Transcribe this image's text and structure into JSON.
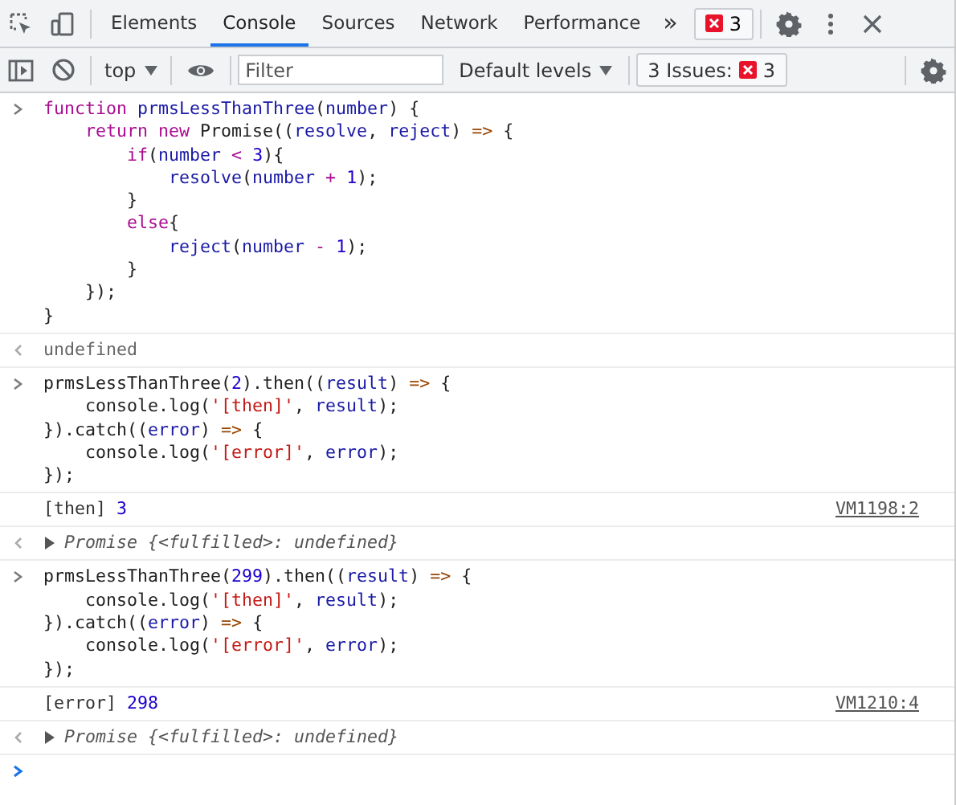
{
  "tabs": [
    {
      "label": "Elements",
      "selected": false
    },
    {
      "label": "Console",
      "selected": true
    },
    {
      "label": "Sources",
      "selected": false
    },
    {
      "label": "Network",
      "selected": false
    },
    {
      "label": "Performance",
      "selected": false
    }
  ],
  "more_tabs": "»",
  "error_count": "3",
  "console_toolbar": {
    "context": "top",
    "filter": {
      "placeholder": "Filter"
    },
    "levels": "Default levels",
    "issues": {
      "label": "3 Issues:",
      "count": "3"
    }
  },
  "entries": [
    {
      "kind": "input",
      "lines": [
        [
          {
            "t": "function",
            "kind": "keyword"
          },
          {
            "t": " prmsLessThanThree",
            "kind": "variable"
          },
          {
            "t": "("
          },
          {
            "t": "number",
            "kind": "variable"
          },
          {
            "t": ") {"
          }
        ],
        [
          {
            "t": "    return",
            "kind": "keyword"
          },
          {
            "t": " new",
            "kind": "keyword"
          },
          {
            "t": " Promise(("
          },
          {
            "t": "resolve",
            "kind": "variable"
          },
          {
            "t": ", "
          },
          {
            "t": "reject",
            "kind": "variable"
          },
          {
            "t": ") "
          },
          {
            "t": "=>",
            "kind": "operator"
          },
          {
            "t": " {"
          }
        ],
        [
          {
            "t": "        if",
            "kind": "keyword"
          },
          {
            "t": "("
          },
          {
            "t": "number",
            "kind": "variable"
          },
          {
            "t": " <",
            "kind": "keyword"
          },
          {
            "t": " 3",
            "kind": "number"
          },
          {
            "t": "){"
          }
        ],
        [
          {
            "t": "            resolve",
            "kind": "variable"
          },
          {
            "t": "("
          },
          {
            "t": "number",
            "kind": "variable"
          },
          {
            "t": " +",
            "kind": "keyword"
          },
          {
            "t": " 1",
            "kind": "number"
          },
          {
            "t": ");"
          }
        ],
        [
          {
            "t": "        }"
          }
        ],
        [
          {
            "t": "        else",
            "kind": "keyword"
          },
          {
            "t": "{"
          }
        ],
        [
          {
            "t": "            reject",
            "kind": "variable"
          },
          {
            "t": "("
          },
          {
            "t": "number",
            "kind": "variable"
          },
          {
            "t": " -",
            "kind": "keyword"
          },
          {
            "t": " 1",
            "kind": "number"
          },
          {
            "t": ");"
          }
        ],
        [
          {
            "t": "        }"
          }
        ],
        [
          {
            "t": "    });"
          }
        ],
        [
          {
            "t": "}"
          }
        ]
      ]
    },
    {
      "kind": "result",
      "text": "undefined"
    },
    {
      "kind": "input",
      "lines": [
        [
          {
            "t": "prmsLessThanThree("
          },
          {
            "t": "2",
            "kind": "number"
          },
          {
            "t": ").then(("
          },
          {
            "t": "result",
            "kind": "variable"
          },
          {
            "t": ") "
          },
          {
            "t": "=>",
            "kind": "operator"
          },
          {
            "t": " {"
          }
        ],
        [
          {
            "t": "    console.log("
          },
          {
            "t": "'[then]'",
            "kind": "string"
          },
          {
            "t": ", "
          },
          {
            "t": "result",
            "kind": "variable"
          },
          {
            "t": ");"
          }
        ],
        [
          {
            "t": "}).catch(("
          },
          {
            "t": "error",
            "kind": "variable"
          },
          {
            "t": ") "
          },
          {
            "t": "=>",
            "kind": "operator"
          },
          {
            "t": " {"
          }
        ],
        [
          {
            "t": "    console.log("
          },
          {
            "t": "'[error]'",
            "kind": "string"
          },
          {
            "t": ", "
          },
          {
            "t": "error",
            "kind": "variable"
          },
          {
            "t": ");"
          }
        ],
        [
          {
            "t": "});"
          }
        ]
      ]
    },
    {
      "kind": "log",
      "text": "[then]",
      "value": "3",
      "source": "VM1198:2"
    },
    {
      "kind": "promise",
      "text": "Promise {<fulfilled>: undefined}",
      "expanded": false
    },
    {
      "kind": "input",
      "lines": [
        [
          {
            "t": "prmsLessThanThree("
          },
          {
            "t": "299",
            "kind": "number"
          },
          {
            "t": ").then(("
          },
          {
            "t": "result",
            "kind": "variable"
          },
          {
            "t": ") "
          },
          {
            "t": "=>",
            "kind": "operator"
          },
          {
            "t": " {"
          }
        ],
        [
          {
            "t": "    console.log("
          },
          {
            "t": "'[then]'",
            "kind": "string"
          },
          {
            "t": ", "
          },
          {
            "t": "result",
            "kind": "variable"
          },
          {
            "t": ");"
          }
        ],
        [
          {
            "t": "}).catch(("
          },
          {
            "t": "error",
            "kind": "variable"
          },
          {
            "t": ") "
          },
          {
            "t": "=>",
            "kind": "operator"
          },
          {
            "t": " {"
          }
        ],
        [
          {
            "t": "    console.log("
          },
          {
            "t": "'[error]'",
            "kind": "string"
          },
          {
            "t": ", "
          },
          {
            "t": "error",
            "kind": "variable"
          },
          {
            "t": ");"
          }
        ],
        [
          {
            "t": "});"
          }
        ]
      ]
    },
    {
      "kind": "log",
      "text": "[error]",
      "value": "298",
      "source": "VM1210:4"
    },
    {
      "kind": "promise",
      "text": "Promise {<fulfilled>: undefined}",
      "expanded": false
    },
    {
      "kind": "prompt"
    }
  ]
}
